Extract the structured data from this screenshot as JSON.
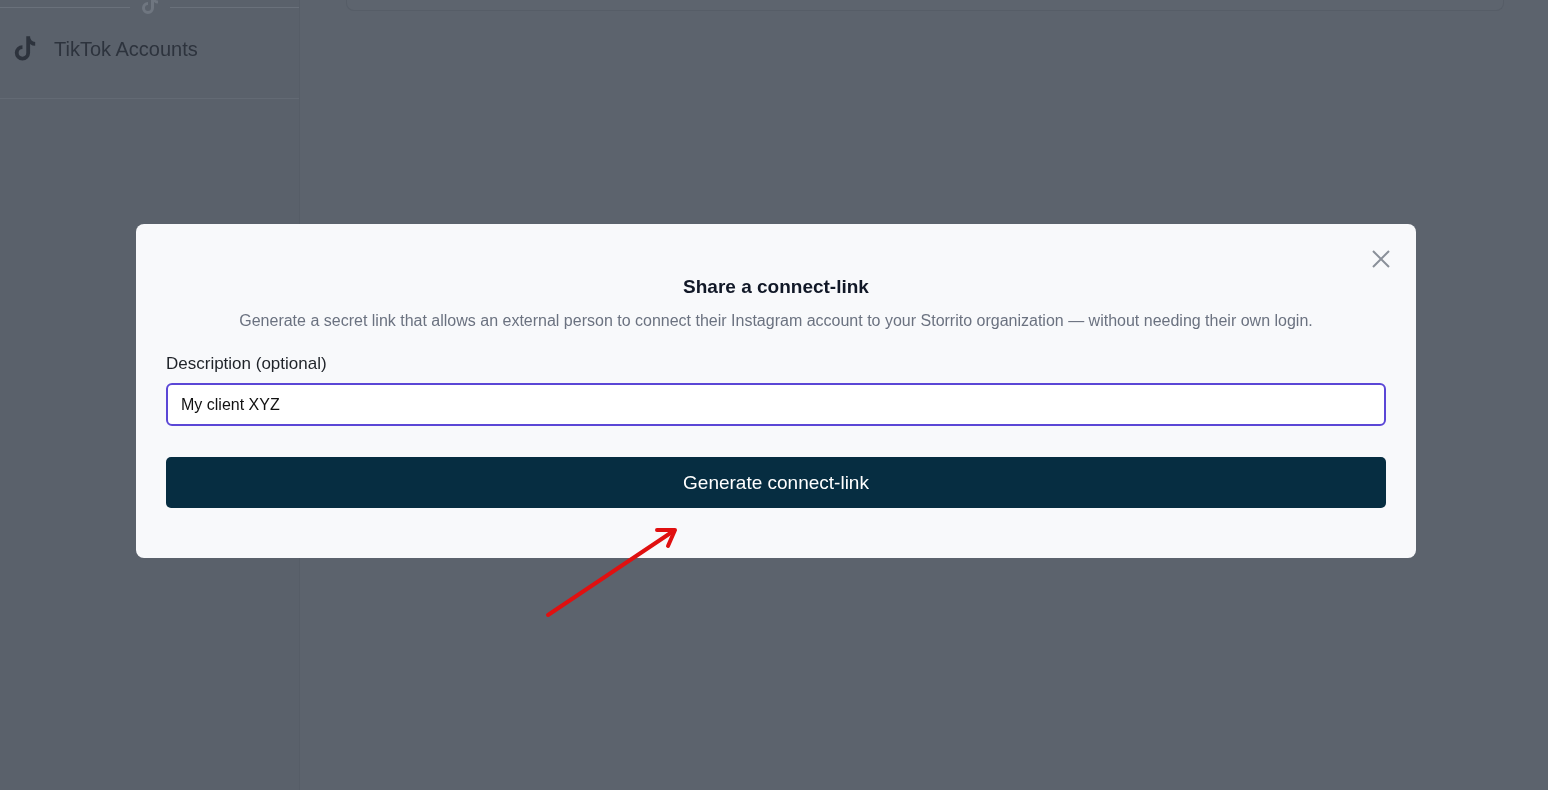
{
  "sidebar": {
    "items": [
      {
        "label": "TikTok Accounts"
      }
    ]
  },
  "dialog": {
    "title": "Share a connect-link",
    "description": "Generate a secret link that allows an external person to connect their Instagram account to your Storrito organization — without needing their own login.",
    "field": {
      "label": "Description (optional)",
      "value": "My client XYZ"
    },
    "button": "Generate connect-link"
  }
}
